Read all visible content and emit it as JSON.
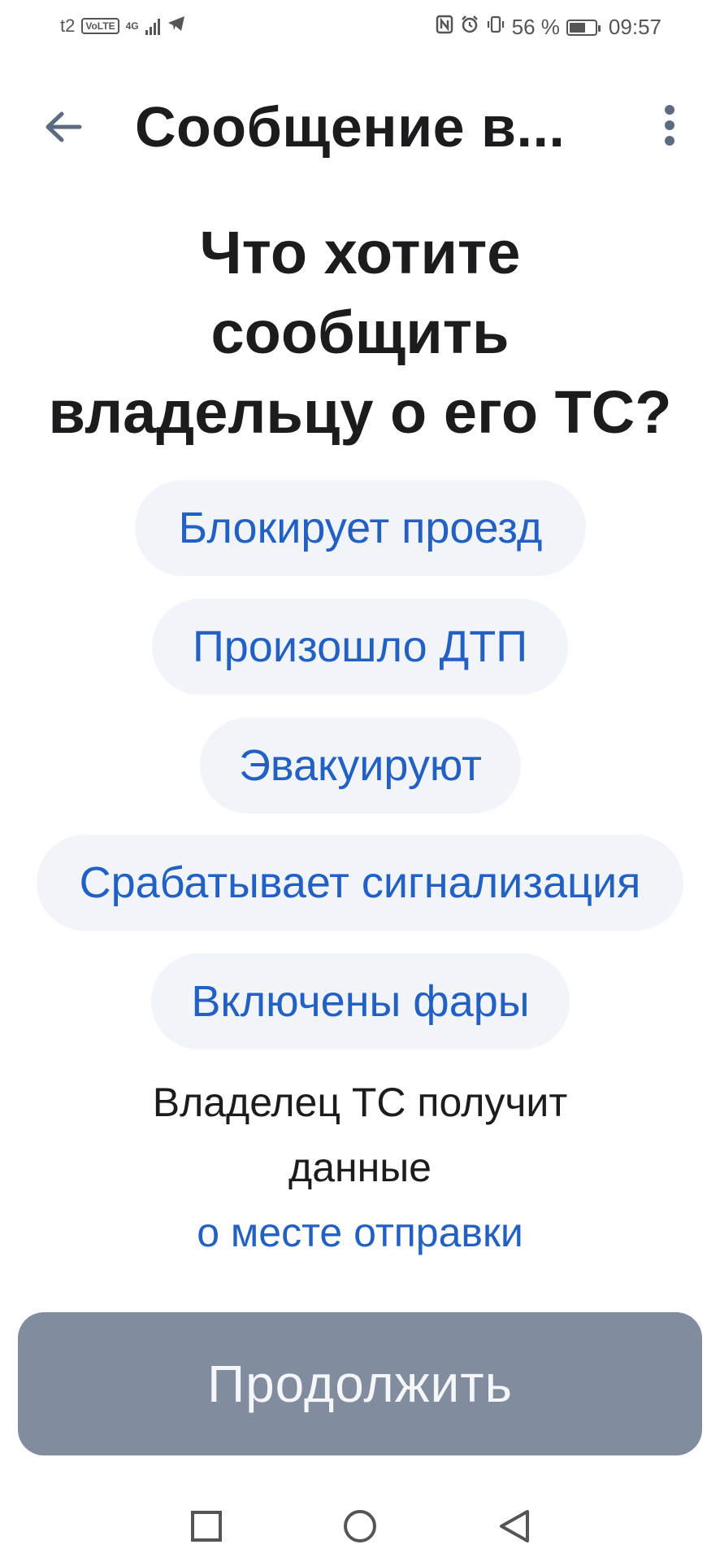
{
  "status_bar": {
    "carrier": "t2",
    "volte": "VoLTE",
    "network": "4G",
    "battery_percent": "56 %",
    "time": "09:57",
    "battery_level": 0.56
  },
  "app_bar": {
    "title": "Сообщение в..."
  },
  "question": {
    "line1": "Что хотите",
    "line2": "сообщить",
    "line3": "владельцу о его ТС?"
  },
  "options": [
    {
      "label": "Блокирует проезд"
    },
    {
      "label": "Произошло ДТП"
    },
    {
      "label": "Эвакуируют"
    },
    {
      "label": "Срабатывает сигнализация"
    },
    {
      "label": "Включены фары"
    }
  ],
  "info": {
    "line1": "Владелец ТС получит",
    "line2": "данные",
    "link": "о месте отправки"
  },
  "continue_label": "Продолжить",
  "colors": {
    "accent": "#2260c4",
    "chip_bg": "#f1f4f8",
    "button_disabled": "#818c9f"
  }
}
